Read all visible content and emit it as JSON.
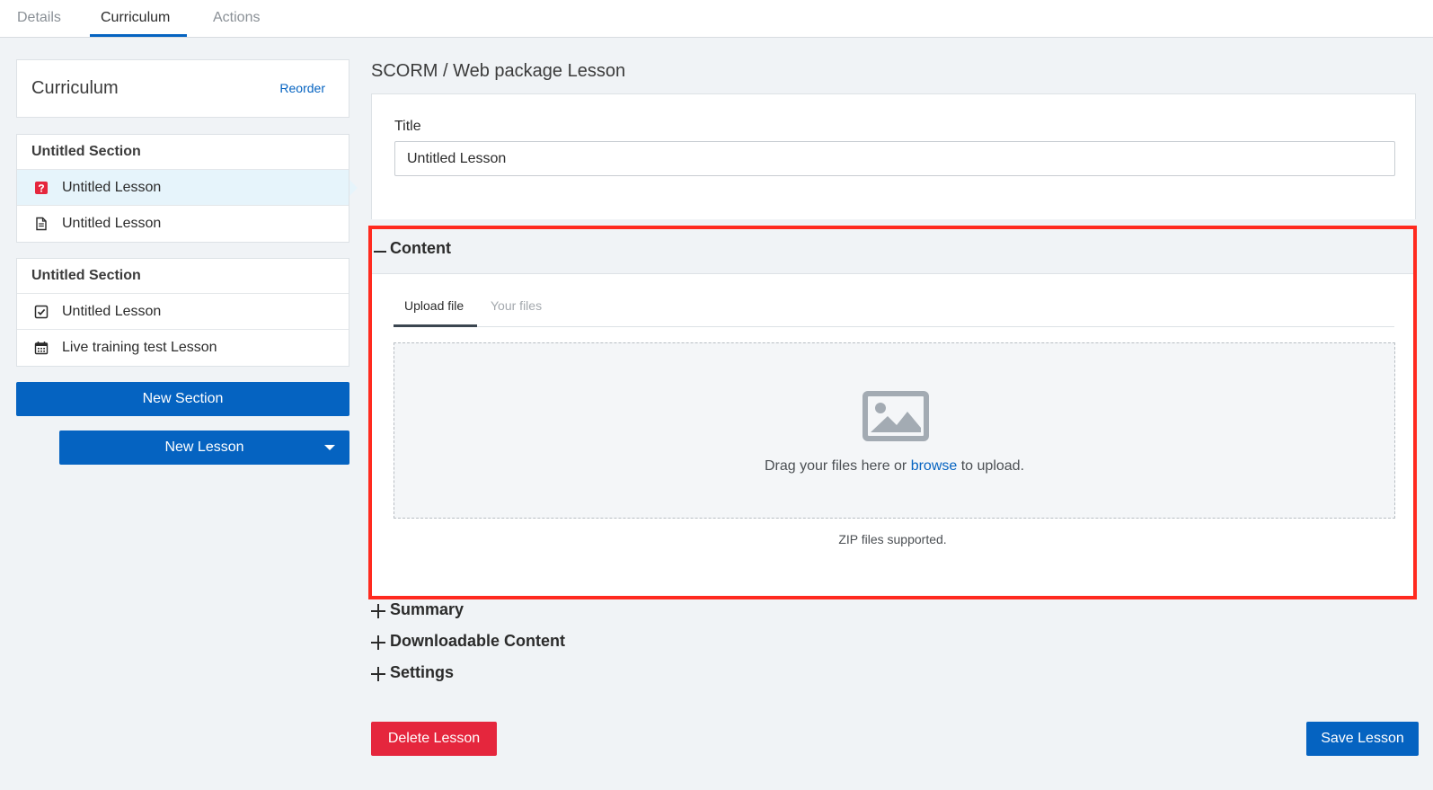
{
  "tabs": [
    {
      "label": "Details",
      "active": false
    },
    {
      "label": "Curriculum",
      "active": true
    },
    {
      "label": "Actions",
      "active": false
    }
  ],
  "sidebar": {
    "title": "Curriculum",
    "reorder_label": "Reorder",
    "sections": [
      {
        "title": "Untitled Section",
        "lessons": [
          {
            "label": "Untitled Lesson",
            "icon": "quiz-icon",
            "selected": true
          },
          {
            "label": "Untitled Lesson",
            "icon": "document-icon",
            "selected": false
          }
        ]
      },
      {
        "title": "Untitled Section",
        "lessons": [
          {
            "label": "Untitled Lesson",
            "icon": "checkbox-icon",
            "selected": false
          },
          {
            "label": "Live training test Lesson",
            "icon": "calendar-icon",
            "selected": false
          }
        ]
      }
    ],
    "new_section_label": "New Section",
    "new_lesson_label": "New Lesson"
  },
  "main": {
    "heading": "SCORM / Web package Lesson",
    "title_label": "Title",
    "title_value": "Untitled Lesson",
    "content": {
      "label": "Content",
      "tabs": [
        {
          "label": "Upload file",
          "active": true
        },
        {
          "label": "Your files",
          "active": false
        }
      ],
      "drop_text_before": "Drag your files here or ",
      "drop_link": "browse",
      "drop_text_after": " to upload.",
      "zip_note": "ZIP files supported."
    },
    "accordions": [
      {
        "label": "Summary"
      },
      {
        "label": "Downloadable Content"
      },
      {
        "label": "Settings"
      }
    ],
    "delete_label": "Delete Lesson",
    "save_label": "Save Lesson"
  },
  "colors": {
    "accent": "#0563c1",
    "danger": "#e5263d",
    "highlight_border": "#ff2a1f",
    "quiz_icon": "#e5263d"
  }
}
